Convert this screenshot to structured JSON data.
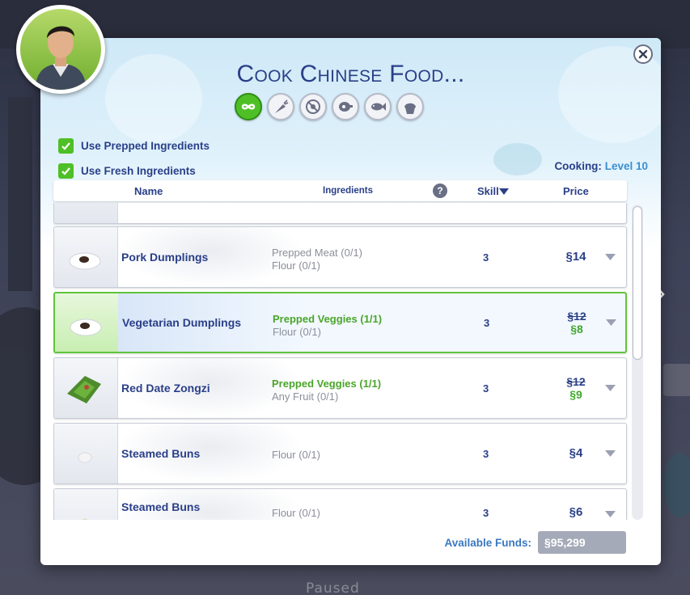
{
  "dialog": {
    "title": "Cook Chinese Food...",
    "close_icon": "close-icon",
    "filters": [
      {
        "name": "filter-all",
        "icon": "infinity-icon",
        "active": true
      },
      {
        "name": "filter-vegetables",
        "icon": "carrot-icon",
        "active": false
      },
      {
        "name": "filter-no-restriction",
        "icon": "restricted-icon",
        "active": false
      },
      {
        "name": "filter-meat",
        "icon": "ham-icon",
        "active": false
      },
      {
        "name": "filter-fish",
        "icon": "fish-icon",
        "active": false
      },
      {
        "name": "filter-dessert",
        "icon": "cupcake-icon",
        "active": false
      }
    ],
    "options": {
      "use_prepped": "Use Prepped Ingredients",
      "use_fresh": "Use Fresh Ingredients"
    },
    "skill": {
      "label": "Cooking:",
      "level": "Level 10"
    },
    "table_header": {
      "name": "Name",
      "ingredients": "Ingredients",
      "help": "?",
      "skill": "Skill",
      "price": "Price"
    },
    "recipes": [
      {
        "name": "Pork Dumplings",
        "ingredients": [
          {
            "text": "Prepped Meat (0/1)",
            "have": false
          },
          {
            "text": "Flour (0/1)",
            "have": false
          }
        ],
        "skill": "3",
        "price": "§14",
        "old_price": "",
        "dish": "plate-dumpling"
      },
      {
        "name": "Vegetarian Dumplings",
        "ingredients": [
          {
            "text": "Prepped Veggies (1/1)",
            "have": true
          },
          {
            "text": "Flour (0/1)",
            "have": false
          }
        ],
        "skill": "3",
        "price": "§8",
        "old_price": "§12",
        "dish": "plate-dumpling",
        "selected": true
      },
      {
        "name": "Red Date Zongzi",
        "ingredients": [
          {
            "text": "Prepped Veggies (1/1)",
            "have": true
          },
          {
            "text": "Any Fruit (0/1)",
            "have": false
          }
        ],
        "skill": "3",
        "price": "§9",
        "old_price": "§12",
        "dish": "leaf-zongzi"
      },
      {
        "name": "Steamed Buns",
        "ingredients": [
          {
            "text": "Flour (0/1)",
            "have": false
          }
        ],
        "skill": "3",
        "price": "§4",
        "old_price": "",
        "dish": "white-bun"
      },
      {
        "name": "Steamed Buns",
        "ingredients": [
          {
            "text": "Flour (0/1)",
            "have": false
          }
        ],
        "skill": "3",
        "price": "§6",
        "old_price": "",
        "dish": "yellow-bun"
      }
    ],
    "funds": {
      "label": "Available Funds:",
      "value": "§95,299"
    }
  },
  "background": {
    "paused": "Paused"
  },
  "colors": {
    "title": "#2a3f88",
    "accent_green": "#4fbf26",
    "price_green": "#3ea82a"
  }
}
